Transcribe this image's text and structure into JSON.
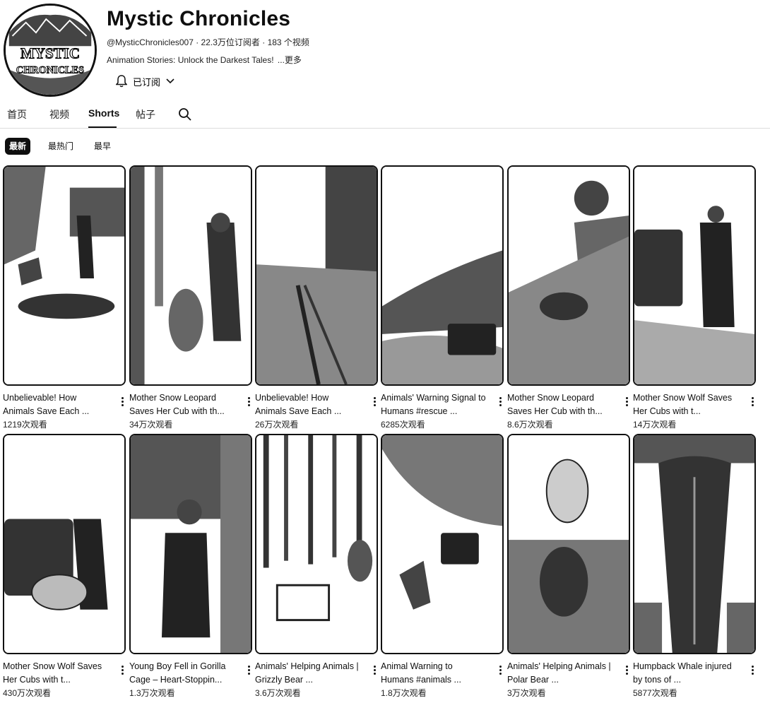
{
  "channel": {
    "name": "Mystic Chronicles",
    "handle": "@MysticChronicles007",
    "meta": "@MysticChronicles007 · 22.3万位订阅者 · 183 个视频",
    "description": "Animation Stories: Unlock the Darkest Tales!",
    "more_label": "...更多",
    "avatar_text_top": "MYSTIC",
    "avatar_text_bottom": "CHRONICLES",
    "subscribe_label": "已订阅"
  },
  "tabs": [
    {
      "label": "首页"
    },
    {
      "label": "视频"
    },
    {
      "label": "Shorts"
    },
    {
      "label": "帖子"
    }
  ],
  "active_tab": "Shorts",
  "chips": [
    {
      "label": "最新"
    },
    {
      "label": "最热门"
    },
    {
      "label": "最早"
    }
  ],
  "shorts": [
    {
      "title": "Unbelievable! How Animals Save Each ...",
      "views": "1219次观看"
    },
    {
      "title": "Mother Snow Leopard Saves Her Cub with th...",
      "views": "34万次观看"
    },
    {
      "title": "Unbelievable! How Animals Save Each ...",
      "views": "26万次观看"
    },
    {
      "title": "Animals' Warning Signal to Humans #rescue ...",
      "views": "6285次观看"
    },
    {
      "title": "Mother Snow Leopard Saves Her Cub with th...",
      "views": "8.6万次观看"
    },
    {
      "title": "Mother Snow Wolf Saves Her Cubs with t...",
      "views": "14万次观看"
    },
    {
      "title": "Mother Snow Wolf Saves Her Cubs with t...",
      "views": "430万次观看"
    },
    {
      "title": "Young Boy Fell in Gorilla Cage – Heart-Stoppin...",
      "views": "1.3万次观看"
    },
    {
      "title": "Animals' Helping Animals | Grizzly Bear ...",
      "views": "3.6万次观看"
    },
    {
      "title": "Animal Warning to Humans #animals ...",
      "views": "1.8万次观看"
    },
    {
      "title": "Animals' Helping Animals | Polar Bear ...",
      "views": "3万次观看"
    },
    {
      "title": "Humpback Whale injured by tons of ...",
      "views": "5877次观看"
    }
  ],
  "icons": {
    "bell": "bell-icon",
    "chevron": "chevron-down-icon",
    "search": "search-icon",
    "more": "more-vert-icon"
  }
}
